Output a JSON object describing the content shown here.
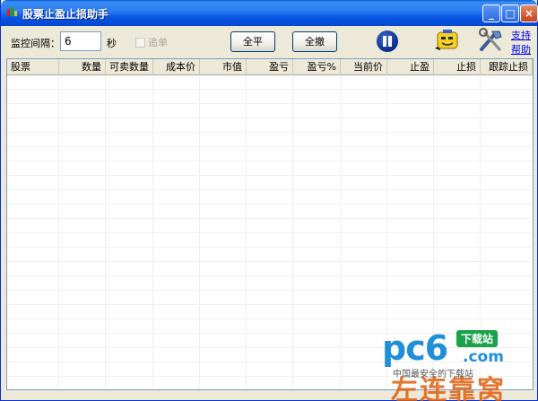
{
  "window": {
    "title": "股票止盈止损助手"
  },
  "toolbar": {
    "interval_label": "监控间隔：",
    "interval_value": "6",
    "seconds_label": "秒",
    "follow_order_label": "追单",
    "close_all_label": "全平",
    "cancel_all_label": "全撤",
    "support_link": "支持",
    "help_link": "帮助"
  },
  "table": {
    "columns": [
      "股票",
      "数量",
      "可卖数量",
      "成本价",
      "市值",
      "盈亏",
      "盈亏%",
      "当前价",
      "止盈",
      "止损",
      "跟踪止损"
    ],
    "rows": []
  },
  "watermark": {
    "brand": "pc6",
    "tag": "下载站",
    "domain": ".com",
    "slogan": "中国最安全的下载站",
    "big_text": "左连靠窝"
  }
}
